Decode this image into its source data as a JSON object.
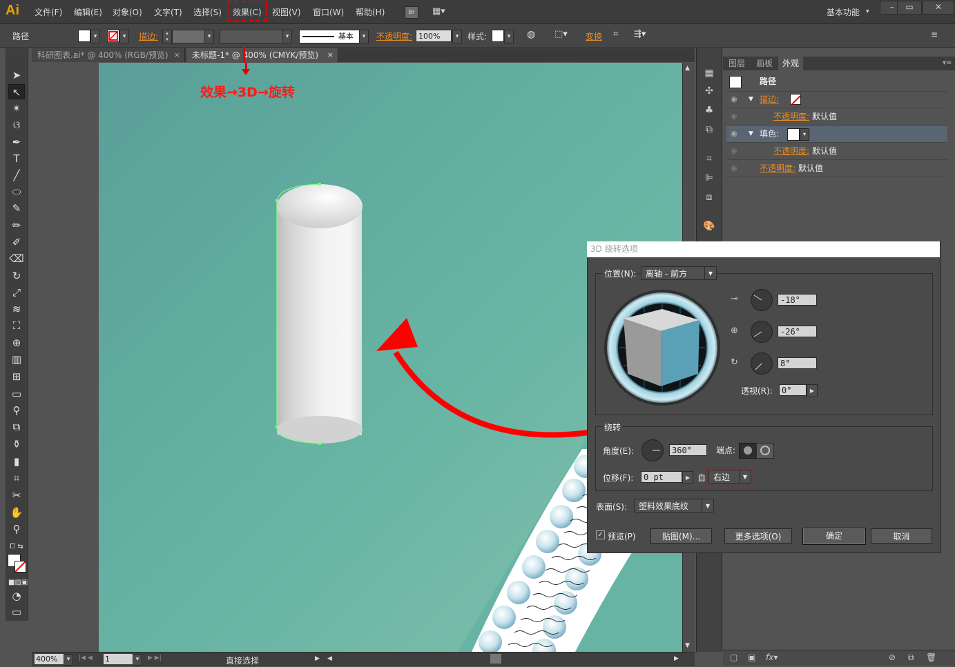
{
  "app": {
    "logo": "Ai"
  },
  "menu": {
    "items": [
      "文件(F)",
      "编辑(E)",
      "对象(O)",
      "文字(T)",
      "选择(S)",
      "效果(C)",
      "视图(V)",
      "窗口(W)",
      "帮助(H)"
    ],
    "bridge": "Br",
    "workspace": "基本功能"
  },
  "control": {
    "object_type": "路径",
    "stroke_label": "描边:",
    "stroke_profile": "基本",
    "opacity_label": "不透明度:",
    "opacity_value": "100%",
    "style_label": "样式:",
    "transform_label": "变换"
  },
  "tabs": [
    {
      "label": "科研图表.ai* @ 400% (RGB/预览)"
    },
    {
      "label": "未标题-1* @ 400% (CMYK/预览)"
    }
  ],
  "annotation": {
    "text": "效果→3D→旋转"
  },
  "status": {
    "zoom": "400%",
    "page": "1",
    "tool": "直接选择"
  },
  "panel": {
    "tabs": [
      "图层",
      "画板",
      "外观"
    ],
    "path_label": "路径",
    "rows": [
      {
        "label": "描边:",
        "value": ""
      },
      {
        "label": "不透明度:",
        "value": "默认值"
      },
      {
        "label": "填色:",
        "value": ""
      },
      {
        "label": "不透明度:",
        "value": "默认值"
      },
      {
        "label": "不透明度:",
        "value": "默认值"
      }
    ]
  },
  "dialog": {
    "title": "3D 绕转选项",
    "position_label": "位置(N):",
    "position_value": "离轴 - 前方",
    "rot_x": "-18°",
    "rot_y": "-26°",
    "rot_z": "8°",
    "perspective_label": "透视(R):",
    "perspective_value": "0°",
    "revolve_title": "绕转",
    "angle_label": "角度(E):",
    "angle_value": "360°",
    "cap_label": "端点:",
    "offset_label": "位移(F):",
    "offset_value": "0 pt",
    "from_label": "自",
    "from_value": "右边",
    "surface_label": "表面(S):",
    "surface_value": "塑料效果底纹",
    "preview_label": "预览(P)",
    "map_button": "贴图(M)...",
    "more_button": "更多选项(O)",
    "ok_button": "确定",
    "cancel_button": "取消"
  },
  "colors": {
    "accent_red": "#e00000",
    "canvas": "#63ab9f",
    "orange": "#e98b22"
  }
}
